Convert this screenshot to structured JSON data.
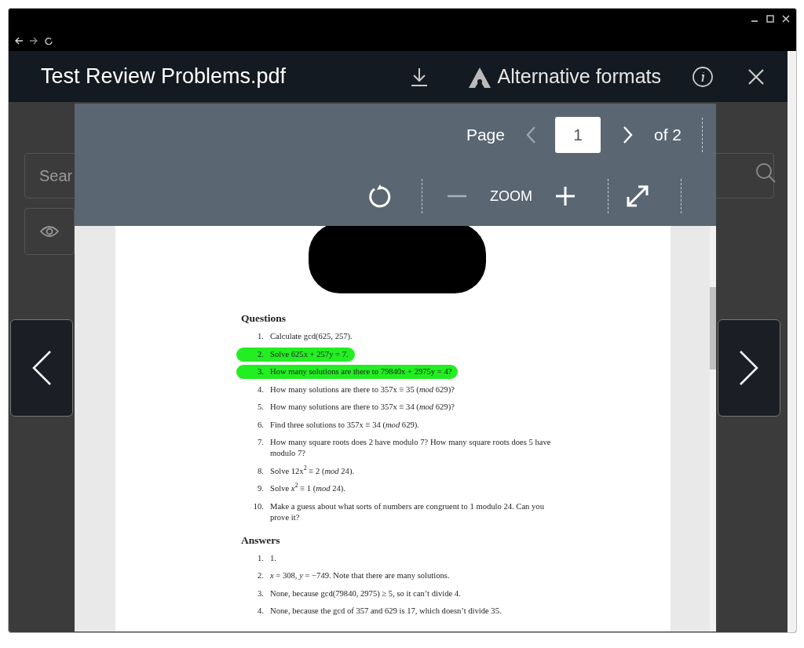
{
  "viewer": {
    "title": "Test Review Problems.pdf",
    "alt_formats": "Alternative formats"
  },
  "background": {
    "search": {
      "placeholder": "Sear"
    }
  },
  "toolbar": {
    "page_label": "Page",
    "page": "1",
    "of": "of 2",
    "zoom_label": "ZOOM"
  },
  "document": {
    "sections": [
      {
        "heading": "Questions",
        "items": [
          {
            "num": "1.",
            "text": "Calculate gcd(625, 257).",
            "highlighted": false
          },
          {
            "num": "2.",
            "text": "Solve 625x + 257y = 7.",
            "highlighted": true
          },
          {
            "num": "3.",
            "text": "How many solutions are there to 79840x + 2975y = 4?",
            "highlighted": true
          },
          {
            "num": "4.",
            "text": "How many solutions are there to 357x ≡ 35 (*mod* 629)?",
            "highlighted": false
          },
          {
            "num": "5.",
            "text": "How many solutions are there to 357x ≡ 34 (*mod* 629)?",
            "highlighted": false
          },
          {
            "num": "6.",
            "text": "Find three solutions to 357x ≡ 34 (*mod* 629).",
            "highlighted": false
          },
          {
            "num": "7.",
            "text": "How many square roots does 2 have modulo 7? How many square roots does 5 have modulo 7?",
            "highlighted": false
          },
          {
            "num": "8.",
            "text": "Solve 12x$^{2}$ ≡ 2 (*mod* 24).",
            "highlighted": false
          },
          {
            "num": "9.",
            "text": "Solve *x*$^{2}$ ≡ 1 (*mod* 24).",
            "highlighted": false
          },
          {
            "num": "10.",
            "text": "Make a guess about what sorts of numbers are congruent to 1 modulo 24. Can you prove it?",
            "highlighted": false
          }
        ]
      },
      {
        "heading": "Answers",
        "items": [
          {
            "num": "1.",
            "text": "1.",
            "highlighted": false
          },
          {
            "num": "2.",
            "text": "*x* = 308, *y* = −749. Note that there are many solutions.",
            "highlighted": false
          },
          {
            "num": "3.",
            "text": "None, because gcd(79840, 2975) ≥ 5, so it can’t divide 4.",
            "highlighted": false
          },
          {
            "num": "4.",
            "text": "None, because the gcd of 357 and 629 is 17, which doesn’t divide 35.",
            "highlighted": false
          }
        ]
      }
    ]
  }
}
